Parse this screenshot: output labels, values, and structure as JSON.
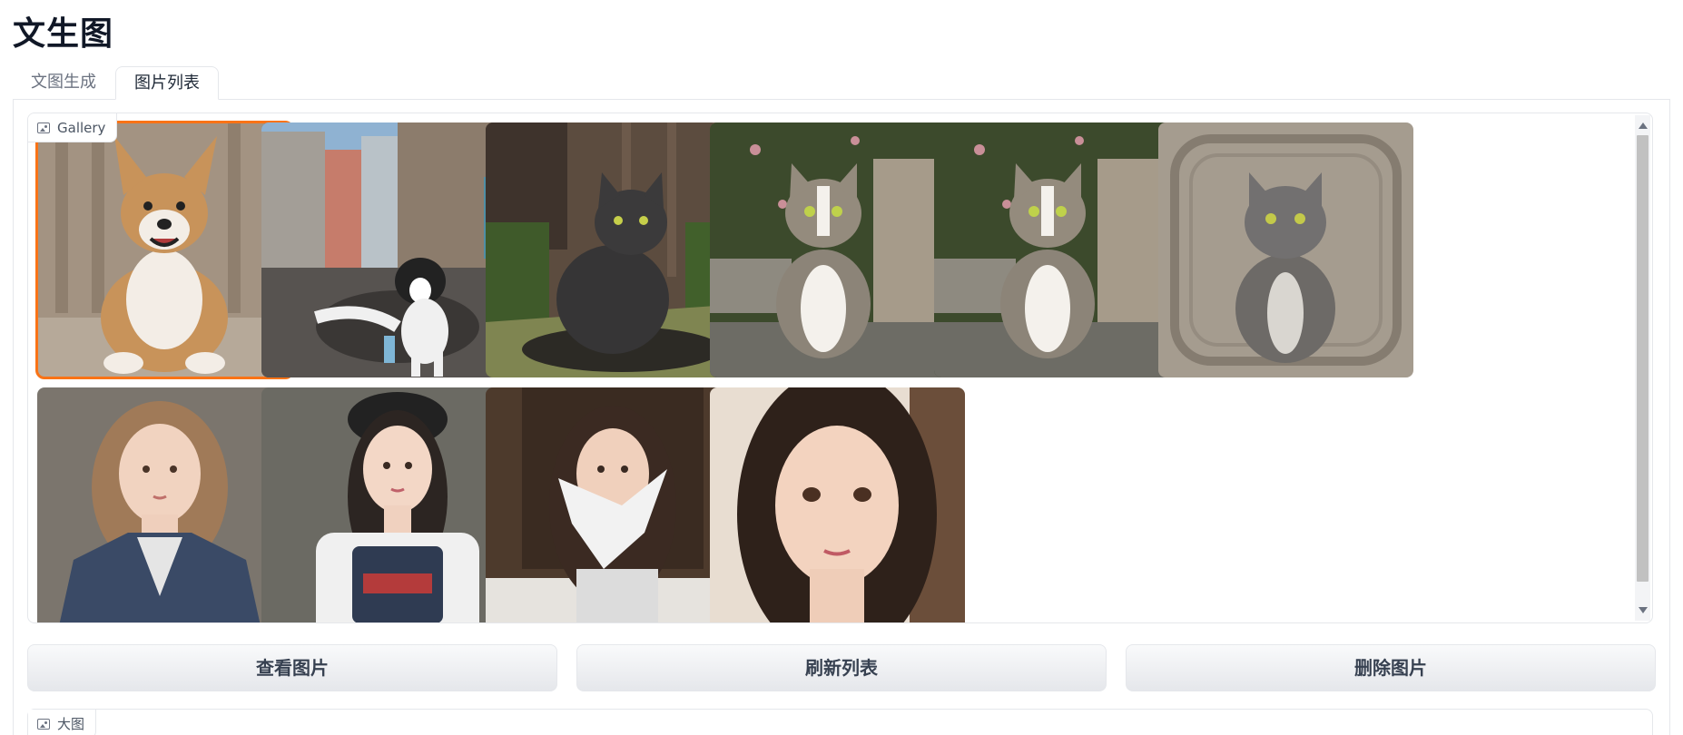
{
  "page": {
    "title": "文生图"
  },
  "tabs": [
    {
      "label": "文图生成",
      "active": false
    },
    {
      "label": "图片列表",
      "active": true
    }
  ],
  "gallery": {
    "label": "Gallery",
    "selected_index": 0,
    "items": [
      {
        "subject": "dog",
        "description_icon": "dog-image"
      },
      {
        "subject": "dog-street",
        "description_icon": "dog-image"
      },
      {
        "subject": "black-cat",
        "description_icon": "cat-image"
      },
      {
        "subject": "tabby-cat-ivy",
        "description_icon": "cat-image"
      },
      {
        "subject": "tabby-cat-ivy-2",
        "description_icon": "cat-image"
      },
      {
        "subject": "grey-tabby-ornate",
        "description_icon": "cat-image"
      },
      {
        "subject": "girl-jacket",
        "description_icon": "portrait-image"
      },
      {
        "subject": "girl-hat",
        "description_icon": "portrait-image"
      },
      {
        "subject": "girl-bow",
        "description_icon": "portrait-image"
      },
      {
        "subject": "girl-closeup",
        "description_icon": "portrait-image"
      }
    ]
  },
  "buttons": {
    "view": "查看图片",
    "refresh": "刷新列表",
    "delete": "删除图片"
  },
  "big_image": {
    "label": "大图"
  },
  "colors": {
    "accent": "#f97316",
    "border": "#e5e7eb"
  }
}
